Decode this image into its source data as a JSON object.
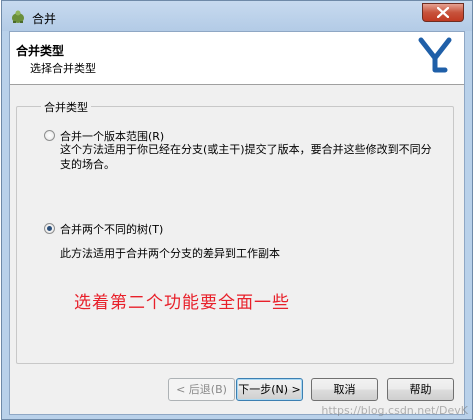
{
  "window": {
    "title": "合并"
  },
  "header": {
    "title": "合并类型",
    "subtitle": "选择合并类型"
  },
  "group": {
    "legend": "合并类型",
    "options": [
      {
        "label": "合并一个版本范围(R)",
        "description": "这个方法适用于你已经在分支(或主干)提交了版本，要合并这些修改到不同分支的场合。",
        "checked": false
      },
      {
        "label": "合并两个不同的树(T)",
        "description": "此方法适用于合并两个分支的差异到工作副本",
        "checked": true
      }
    ]
  },
  "annotation": {
    "text": "选着第二个功能要全面一些",
    "color": "#e8202a"
  },
  "buttons": {
    "back": "< 后退(B)",
    "next": "下一步(N) >",
    "cancel": "取消",
    "help": "帮助"
  },
  "watermark": "https://blog.csdn.net/DevK"
}
